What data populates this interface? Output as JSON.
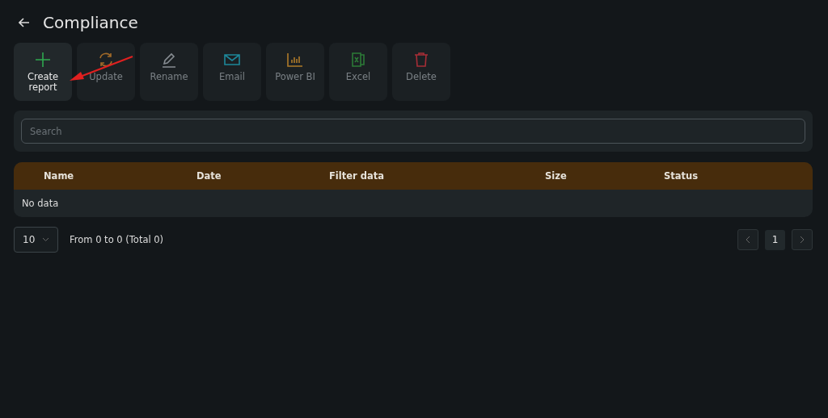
{
  "header": {
    "title": "Compliance"
  },
  "toolbar": [
    {
      "kind": "plus",
      "label": "Create report",
      "disabled": false
    },
    {
      "kind": "refresh",
      "label": "Update",
      "disabled": true
    },
    {
      "kind": "pencil",
      "label": "Rename",
      "disabled": true
    },
    {
      "kind": "mail",
      "label": "Email",
      "disabled": true
    },
    {
      "kind": "chart",
      "label": "Power BI",
      "disabled": true
    },
    {
      "kind": "excel",
      "label": "Excel",
      "disabled": true
    },
    {
      "kind": "trash",
      "label": "Delete",
      "disabled": true
    }
  ],
  "search": {
    "placeholder": "Search"
  },
  "table": {
    "columns": [
      "Name",
      "Date",
      "Filter data",
      "Size",
      "Status"
    ],
    "empty_text": "No data"
  },
  "pagination": {
    "page_size": "10",
    "summary": "From 0 to 0 (Total 0)",
    "prev_disabled": true,
    "pages": [
      {
        "label": "1",
        "selected": true
      }
    ],
    "next_disabled": true
  },
  "annotation": {
    "kind": "arrow"
  }
}
